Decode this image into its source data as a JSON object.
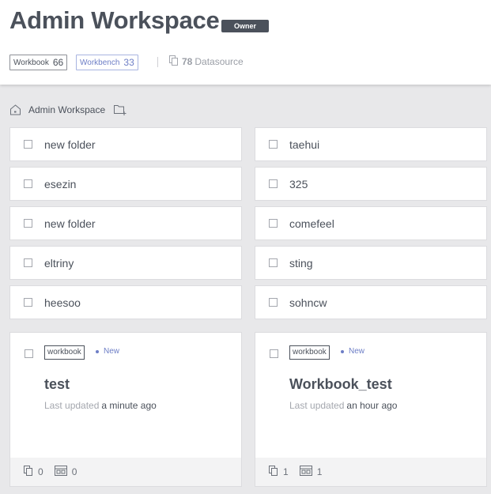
{
  "header": {
    "title": "Admin Workspace",
    "owner_badge": "Owner",
    "stats": {
      "workbook_label": "Workbook",
      "workbook_count": "66",
      "workbench_label": "Workbench",
      "workbench_count": "33",
      "datasource_count": "78",
      "datasource_label": "Datasource"
    }
  },
  "breadcrumb": {
    "current": "Admin Workspace"
  },
  "folders": [
    {
      "name": "new folder"
    },
    {
      "name": "taehui"
    },
    {
      "name": "esezin"
    },
    {
      "name": "325"
    },
    {
      "name": "new folder"
    },
    {
      "name": "comefeel"
    },
    {
      "name": "eltriny"
    },
    {
      "name": "sting"
    },
    {
      "name": "heesoo"
    },
    {
      "name": "sohncw"
    }
  ],
  "workbooks": [
    {
      "type": "workbook",
      "badge": "New",
      "name": "test",
      "updated_label": "Last updated",
      "updated_value": "a minute ago",
      "dashboard_count": "0",
      "chart_count": "0"
    },
    {
      "type": "workbook",
      "badge": "New",
      "name": "Workbook_test",
      "updated_label": "Last updated",
      "updated_value": "an hour ago",
      "dashboard_count": "1",
      "chart_count": "1"
    }
  ]
}
